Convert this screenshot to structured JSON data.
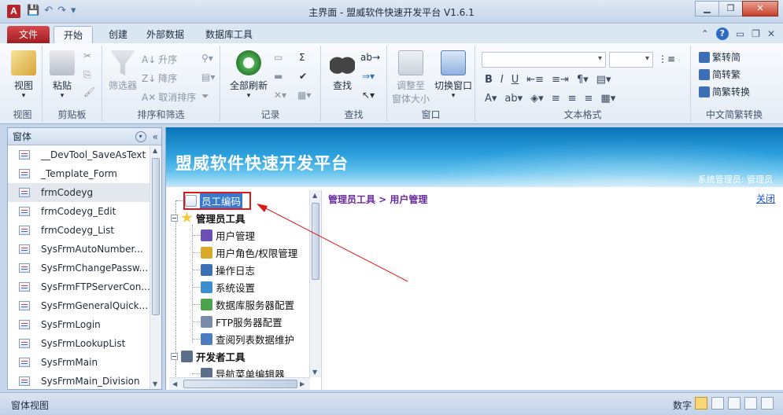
{
  "window": {
    "title": "主界面 - 盟威软件快速开发平台 V1.6.1",
    "app_logo": "A",
    "controls": [
      "minimize",
      "restore",
      "close"
    ]
  },
  "ribbon_tabs": [
    "文件",
    "开始",
    "创建",
    "外部数据",
    "数据库工具"
  ],
  "ribbon": {
    "view": {
      "label": "视图",
      "group": "视图"
    },
    "clipboard": {
      "paste": "粘贴",
      "group": "剪贴板"
    },
    "sort_filter": {
      "filter": "筛选器",
      "asc": "升序",
      "desc": "降序",
      "clear": "取消排序",
      "group": "排序和筛选"
    },
    "records": {
      "refresh": "全部刷新",
      "group": "记录"
    },
    "find": {
      "find": "查找",
      "group": "查找"
    },
    "window": {
      "fit": "调整至",
      "fit2": "窗体大小",
      "switch": "切换窗口",
      "group": "窗口"
    },
    "text_format": {
      "group": "文本格式",
      "bold": "B",
      "italic": "I",
      "underline": "U"
    },
    "chinese": {
      "t2s": "繁转简",
      "s2t": "简转繁",
      "convert": "简繁转换",
      "group": "中文简繁转换"
    }
  },
  "nav_pane": {
    "title": "窗体",
    "items": [
      "__DevTool_SaveAsText",
      "_Template_Form",
      "frmCodeyg",
      "frmCodeyg_Edit",
      "frmCodeyg_List",
      "SysFrmAutoNumber...",
      "SysFrmChangePassw...",
      "SysFrmFTPServerCon...",
      "SysFrmGeneralQuick...",
      "SysFrmLogin",
      "SysFrmLookupList",
      "SysFrmMain",
      "SysFrmMain_Division"
    ],
    "selected_index": 2
  },
  "banner": {
    "title": "盟威软件快速开发平台",
    "user": "系统管理员: 管理员"
  },
  "tree": {
    "top_node": "员工编码",
    "groups": [
      {
        "label": "管理员工具",
        "children": [
          "用户管理",
          "用户角色/权限管理",
          "操作日志",
          "系统设置",
          "数据库服务器配置",
          "FTP服务器配置",
          "查阅列表数据维护"
        ]
      },
      {
        "label": "开发者工具",
        "children": [
          "导航菜单编辑器"
        ]
      }
    ]
  },
  "breadcrumb": "管理员工具 > 用户管理",
  "close_link": "关闭",
  "status": {
    "left": "窗体视图",
    "right": "数字"
  },
  "colors": {
    "annotation": "#e01818",
    "accent": "#2b9fdc"
  }
}
